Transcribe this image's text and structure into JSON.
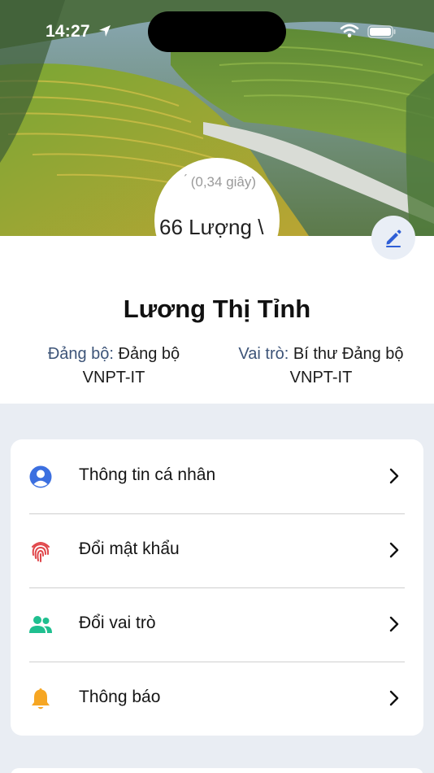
{
  "status_bar": {
    "time": "14:27",
    "icons": [
      "location-arrow-icon",
      "wifi-icon",
      "battery-icon"
    ]
  },
  "avatar": {
    "overlay_text_1": "́ (0,34 giây)",
    "overlay_text_2": "66 Lượng \\"
  },
  "profile": {
    "name": "Lương Thị Tỉnh",
    "party_label": "Đảng bộ:",
    "party_value_line1": "Đảng bộ",
    "party_value_line2": "VNPT-IT",
    "role_label": "Vai trò:",
    "role_value_line1": "Bí thư Đảng bộ",
    "role_value_line2": "VNPT-IT",
    "edit_icon": "pencil-icon"
  },
  "menu": {
    "items": [
      {
        "label": "Thông tin cá nhân",
        "icon": "user-circle-icon",
        "color": "#3b6fe0"
      },
      {
        "label": "Đổi mật khẩu",
        "icon": "fingerprint-icon",
        "color": "#e0464a"
      },
      {
        "label": "Đổi vai trò",
        "icon": "users-icon",
        "color": "#1fbf8f"
      },
      {
        "label": "Thông báo",
        "icon": "bell-icon",
        "color": "#f6a623"
      }
    ]
  },
  "colors": {
    "accent": "#2f5fd6",
    "page_background": "#e9edf3",
    "label_blue": "#3d5478"
  }
}
